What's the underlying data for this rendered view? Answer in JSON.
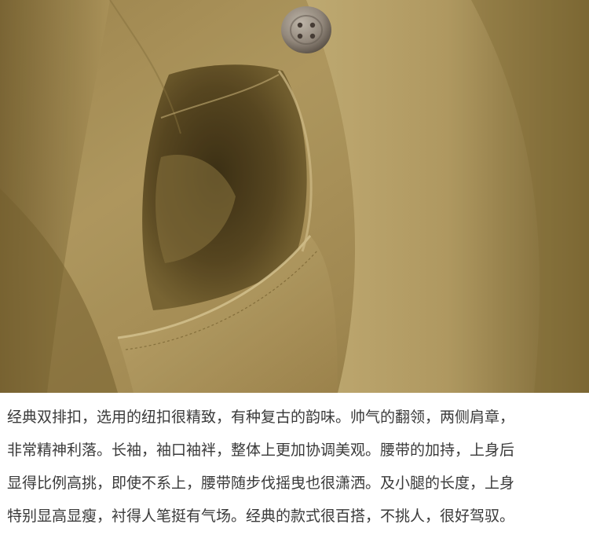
{
  "photo": {
    "subject_icon": "trench-coat-pocket-photo",
    "colors": {
      "fabric_light": "#c2aa6e",
      "fabric_mid": "#a88f55",
      "fabric_dark": "#6f5b2d",
      "pocket_shadow": "#4e3f1c",
      "button": "#9a8f82"
    }
  },
  "description": {
    "lines": [
      "经典双排扣，选用的纽扣很精致，有种复古的韵味。帅气的翻领，两侧肩章，",
      "非常精神利落。长袖，袖口袖袢，整体上更加协调美观。腰带的加持，上身后",
      "显得比例高挑，即使不系上，腰带随步伐摇曳也很潇洒。及小腿的长度，上身",
      "特别显高显瘦，衬得人笔挺有气场。经典的款式很百搭，不挑人，很好驾驭。"
    ],
    "text_color": "#3a3a3a"
  }
}
